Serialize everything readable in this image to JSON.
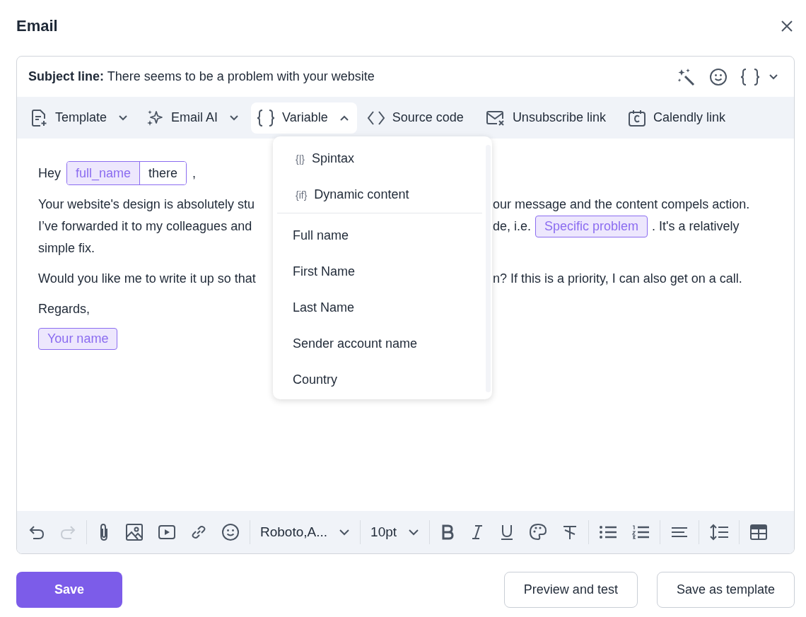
{
  "dialog": {
    "title": "Email"
  },
  "subject": {
    "label": "Subject line:",
    "value": "There seems to be a problem with your website"
  },
  "toolbar": [
    {
      "label": "Template",
      "kind": "template",
      "menu": true,
      "selected": false
    },
    {
      "label": "Email AI",
      "kind": "ai",
      "menu": true,
      "selected": false
    },
    {
      "label": "Variable",
      "kind": "variable",
      "menu": true,
      "selected": true
    },
    {
      "label": "Source code",
      "kind": "code",
      "menu": false,
      "selected": false
    },
    {
      "label": "Unsubscribe link",
      "kind": "unsubscribe",
      "menu": false,
      "selected": false
    },
    {
      "label": "Calendly link",
      "kind": "calendar",
      "menu": false,
      "selected": false
    }
  ],
  "variable_menu": {
    "items": [
      {
        "kind": "special",
        "icon": "{|}",
        "label": "Spintax"
      },
      {
        "kind": "special",
        "icon": "{if}",
        "label": "Dynamic content"
      },
      {
        "kind": "field",
        "label": "Full name"
      },
      {
        "kind": "field",
        "label": "First Name"
      },
      {
        "kind": "field",
        "label": "Last Name"
      },
      {
        "kind": "field",
        "label": "Sender account name"
      },
      {
        "kind": "field",
        "label": "Country"
      }
    ]
  },
  "body": [
    {
      "kind": "greeting",
      "text": "Hey",
      "variable": "full_name",
      "fallback": "there",
      "suffix": ","
    },
    {
      "kind": "paragraph",
      "lines": [
        {
          "left": "Your website's design is absolutely stu",
          "right": "our message and the content compels action."
        },
        {
          "left": "I’ve forwarded it to my colleagues and",
          "right": "de, i.e.",
          "chip": "Specific problem",
          "after": ". It's a relatively"
        },
        {
          "text": "simple fix."
        }
      ]
    },
    {
      "kind": "paragraph",
      "lines": [
        {
          "left": "Would you like me to write it up so that",
          "right": "n? If this is a priority, I can also get on a call."
        }
      ]
    },
    {
      "kind": "line",
      "text": "Regards,"
    },
    {
      "kind": "chip",
      "chip": "Your name"
    }
  ],
  "format_bar": {
    "redo_disabled": true,
    "font": "Roboto,A...",
    "size": "10pt"
  },
  "buttons": {
    "save": "Save",
    "preview": "Preview and test",
    "save_template": "Save as template"
  }
}
